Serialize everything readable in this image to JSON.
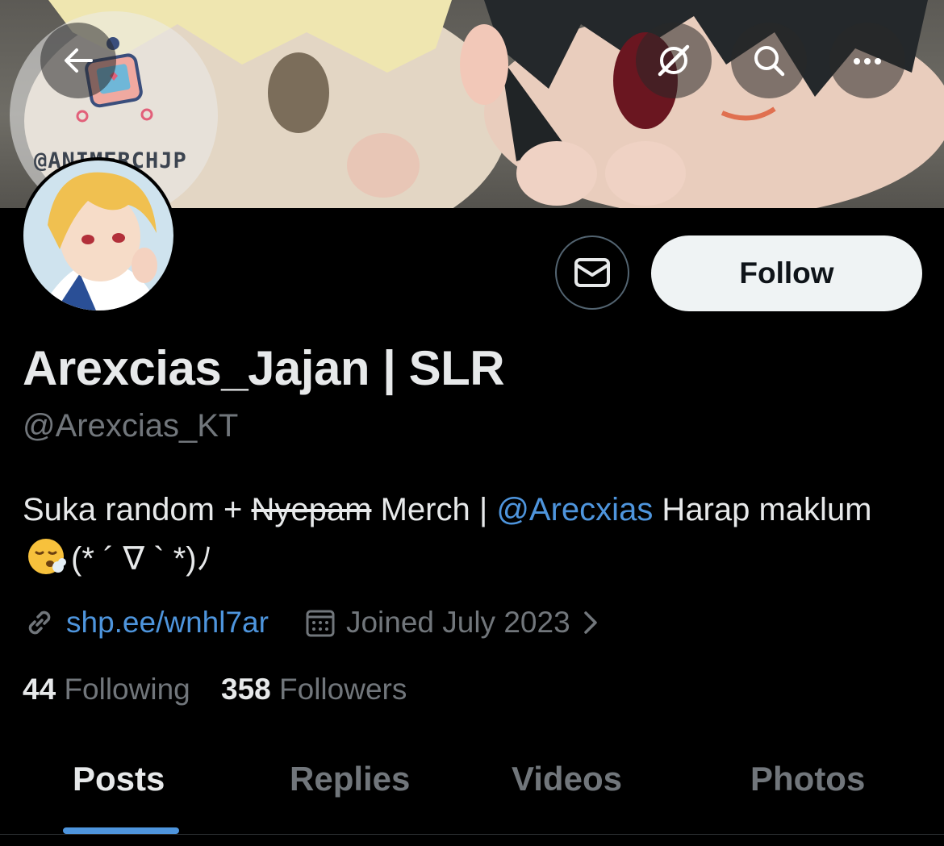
{
  "banner": {
    "watermark": "@ANIMERCHJP"
  },
  "nav": {
    "back_icon": "arrow-left-icon",
    "grok_icon": "grok-icon",
    "search_icon": "search-icon",
    "more_icon": "more-horizontal-icon"
  },
  "profile": {
    "display_name": "Arexcias_Jajan | SLR",
    "handle": "@Arexcias_KT",
    "bio": {
      "part1": "Suka random + ",
      "strike": "Nyepam",
      "part2": " Merch | ",
      "mention": "@Arecxias",
      "part3": " Harap maklum ",
      "emoji": "face-exhaling-emoji",
      "kaomoji": "(* ´ ∇ ` *)ﾉ"
    },
    "link": "shp.ee/wnhl7ar",
    "joined": "Joined July 2023",
    "following_count": "44",
    "following_label": "Following",
    "followers_count": "358",
    "followers_label": "Followers"
  },
  "actions": {
    "message_icon": "envelope-icon",
    "follow_label": "Follow"
  },
  "tabs": [
    {
      "label": "Posts",
      "active": true
    },
    {
      "label": "Replies",
      "active": false
    },
    {
      "label": "Videos",
      "active": false
    },
    {
      "label": "Photos",
      "active": false
    }
  ],
  "colors": {
    "accent": "#4e95dd",
    "muted": "#71767b",
    "background": "#000000"
  }
}
